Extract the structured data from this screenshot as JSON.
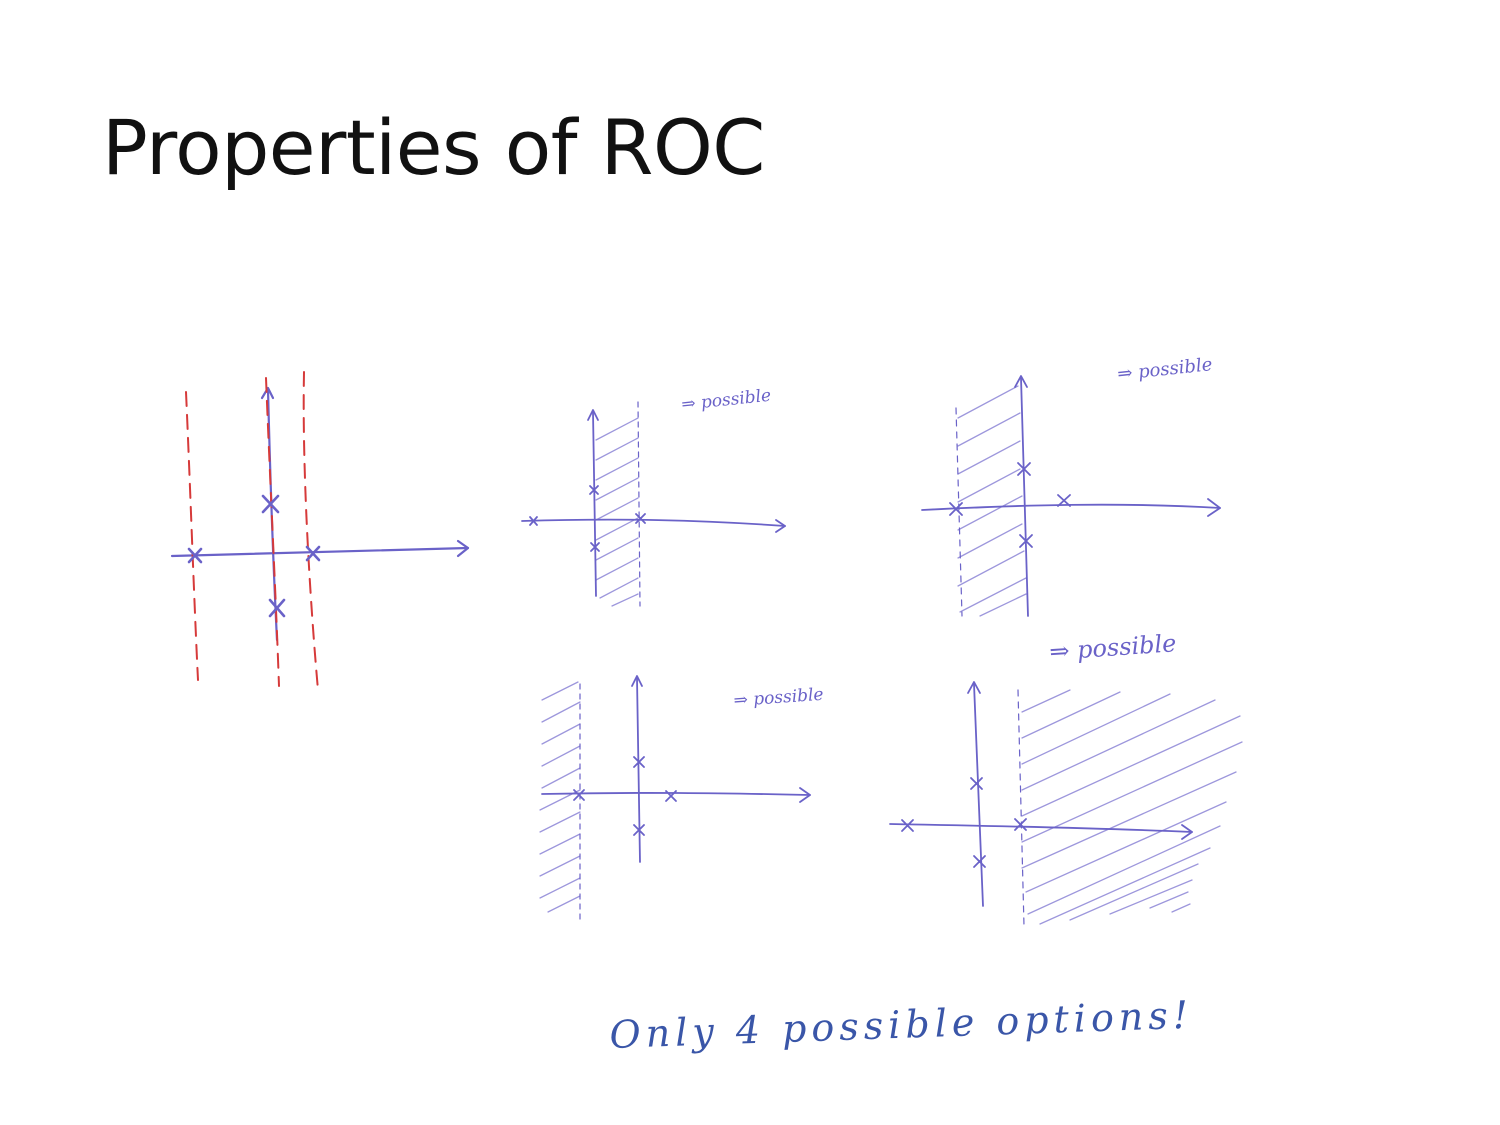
{
  "slide": {
    "title": "Properties of ROC",
    "caption": "Only 4 possible options!"
  },
  "panels": [
    {
      "id": "pole-zero-plot",
      "label": ""
    },
    {
      "id": "roc-strip",
      "label": "⇒ possible"
    },
    {
      "id": "roc-left-of-jw",
      "label": "⇒ possible"
    },
    {
      "id": "roc-left-of-leftmost-pole",
      "label": "⇒ possible"
    },
    {
      "id": "roc-right-of-rightmost-pole",
      "label": "⇒ possible"
    }
  ],
  "colors": {
    "ink": "#6a62c8",
    "boundary": "#d63a3a",
    "hatch": "#9d97dc",
    "caption": "#3a56a8",
    "title": "#111111"
  }
}
